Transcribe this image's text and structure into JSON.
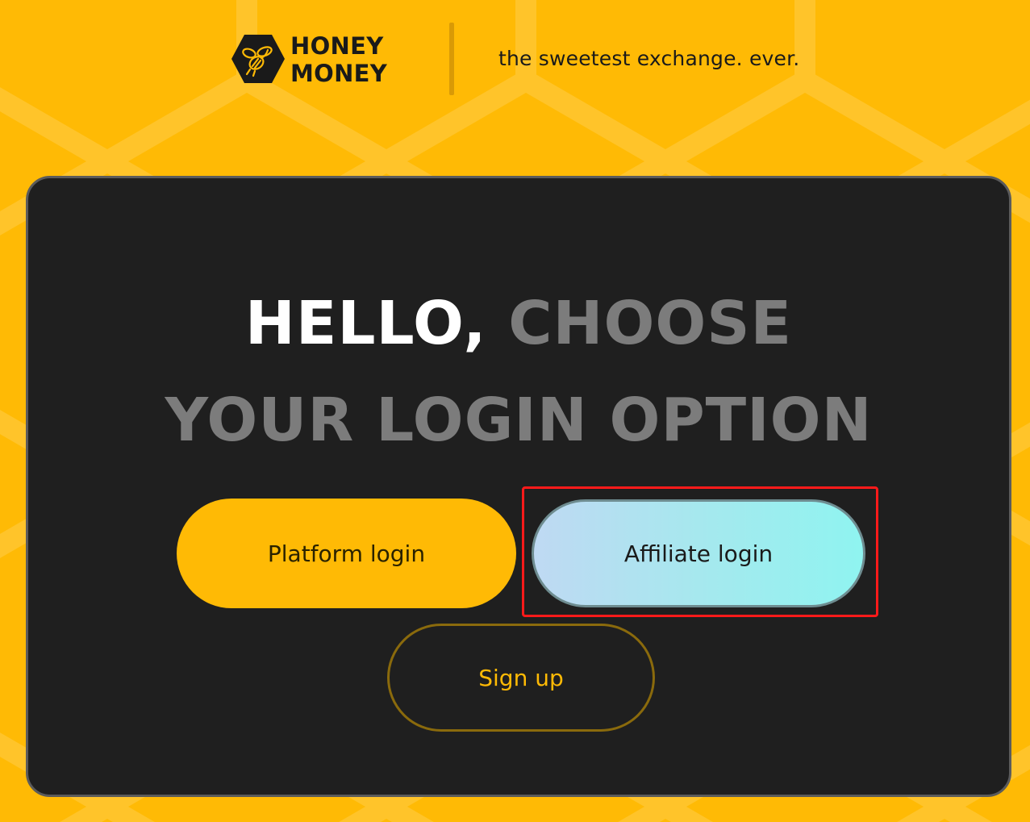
{
  "brand": {
    "logo_line1": "HONEY",
    "logo_line2": "MONEY",
    "tagline": "the sweetest exchange. ever.",
    "logo_icon": "bee-hexagon-icon"
  },
  "card": {
    "headline_white": "HELLO,",
    "headline_grey_1": "CHOOSE",
    "headline_grey_2": "YOUR LOGIN OPTION"
  },
  "buttons": {
    "platform_login": "Platform login",
    "affiliate_login": "Affiliate login",
    "sign_up": "Sign up"
  },
  "colors": {
    "background": "#FFBA05",
    "card": "#1f1f1f",
    "accent": "#FFBA05",
    "affiliate_gradient_start": "#bfd9f3",
    "affiliate_gradient_end": "#8ff4f0",
    "highlight": "#ff1a1a"
  }
}
